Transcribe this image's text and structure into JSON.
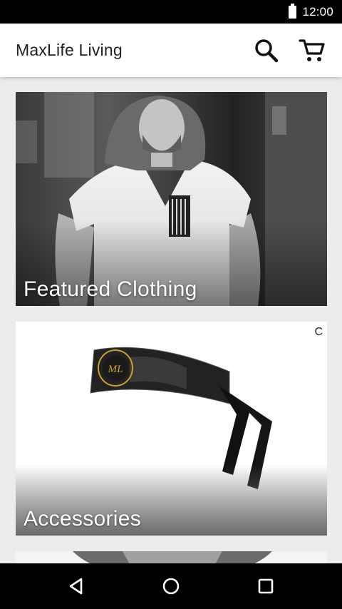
{
  "status_bar": {
    "time": "12:00"
  },
  "app_bar": {
    "title": "MaxLife Living",
    "icons": [
      "search-icon",
      "cart-icon"
    ]
  },
  "categories": [
    {
      "label": "Featured Clothing"
    },
    {
      "label": "Accessories",
      "badge": "C"
    },
    {
      "label": ""
    }
  ],
  "nav_bar": {
    "icons": [
      "back-icon",
      "home-icon",
      "recents-icon"
    ]
  },
  "colors": {
    "app_bar_bg": "#ffffff",
    "page_bg": "#ececec",
    "system_bars": "#000000"
  }
}
